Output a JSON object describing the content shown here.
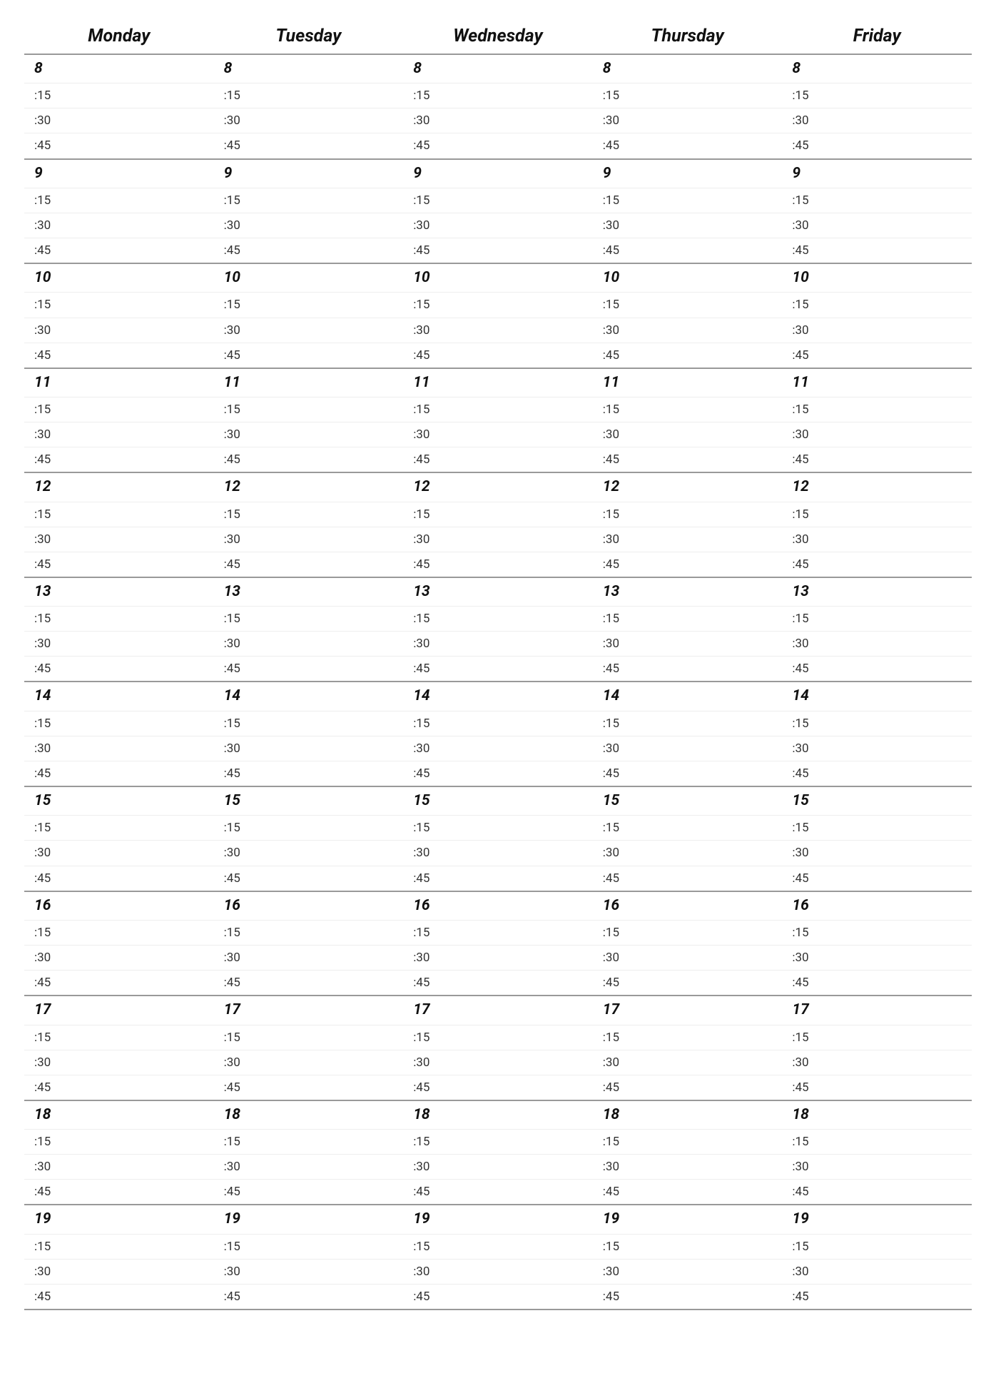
{
  "days": [
    "Monday",
    "Tuesday",
    "Wednesday",
    "Thursday",
    "Friday"
  ],
  "hours": [
    8,
    9,
    10,
    11,
    12,
    13,
    14,
    15,
    16,
    17,
    18,
    19
  ],
  "minute_labels": [
    ":15",
    ":30",
    ":45"
  ]
}
